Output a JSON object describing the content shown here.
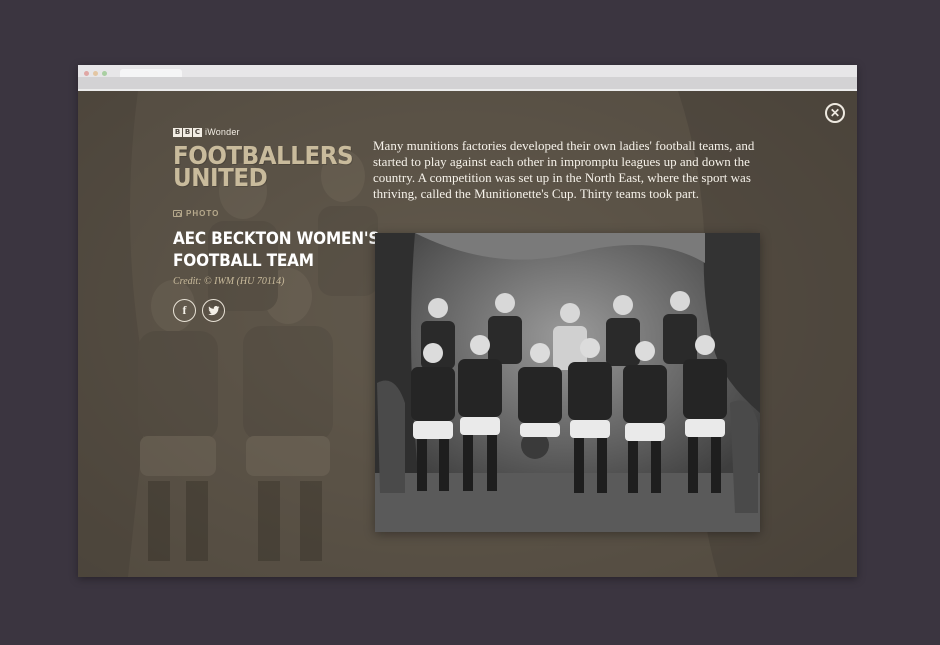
{
  "brand": {
    "bbc_letters": [
      "B",
      "B",
      "C"
    ],
    "product": "iWonder",
    "series_title_line1": "FOOTBALLERS",
    "series_title_line2": "UNITED"
  },
  "media": {
    "type_label": "PHOTO",
    "icon": "camera-icon",
    "title_line1": "AEC BECKTON WOMEN'S",
    "title_line2": "FOOTBALL TEAM",
    "credit": "Credit: © IWM (HU 70114)"
  },
  "share": {
    "facebook_glyph": "f",
    "twitter_icon": "twitter-bird-icon"
  },
  "close": {
    "icon": "close-icon"
  },
  "body": {
    "paragraph": "Many munitions factories developed their own ladies' football teams, and started to play against each other in impromptu leagues up and down the country. A competition was set up in the North East, where the sport was thriving, called the Munitionette's Cup. Thirty teams took part."
  },
  "colors": {
    "page_background": "#3b3540",
    "overlay": "#5e564a",
    "accent_title": "#c9bb9c",
    "text": "#f6f2ea"
  }
}
